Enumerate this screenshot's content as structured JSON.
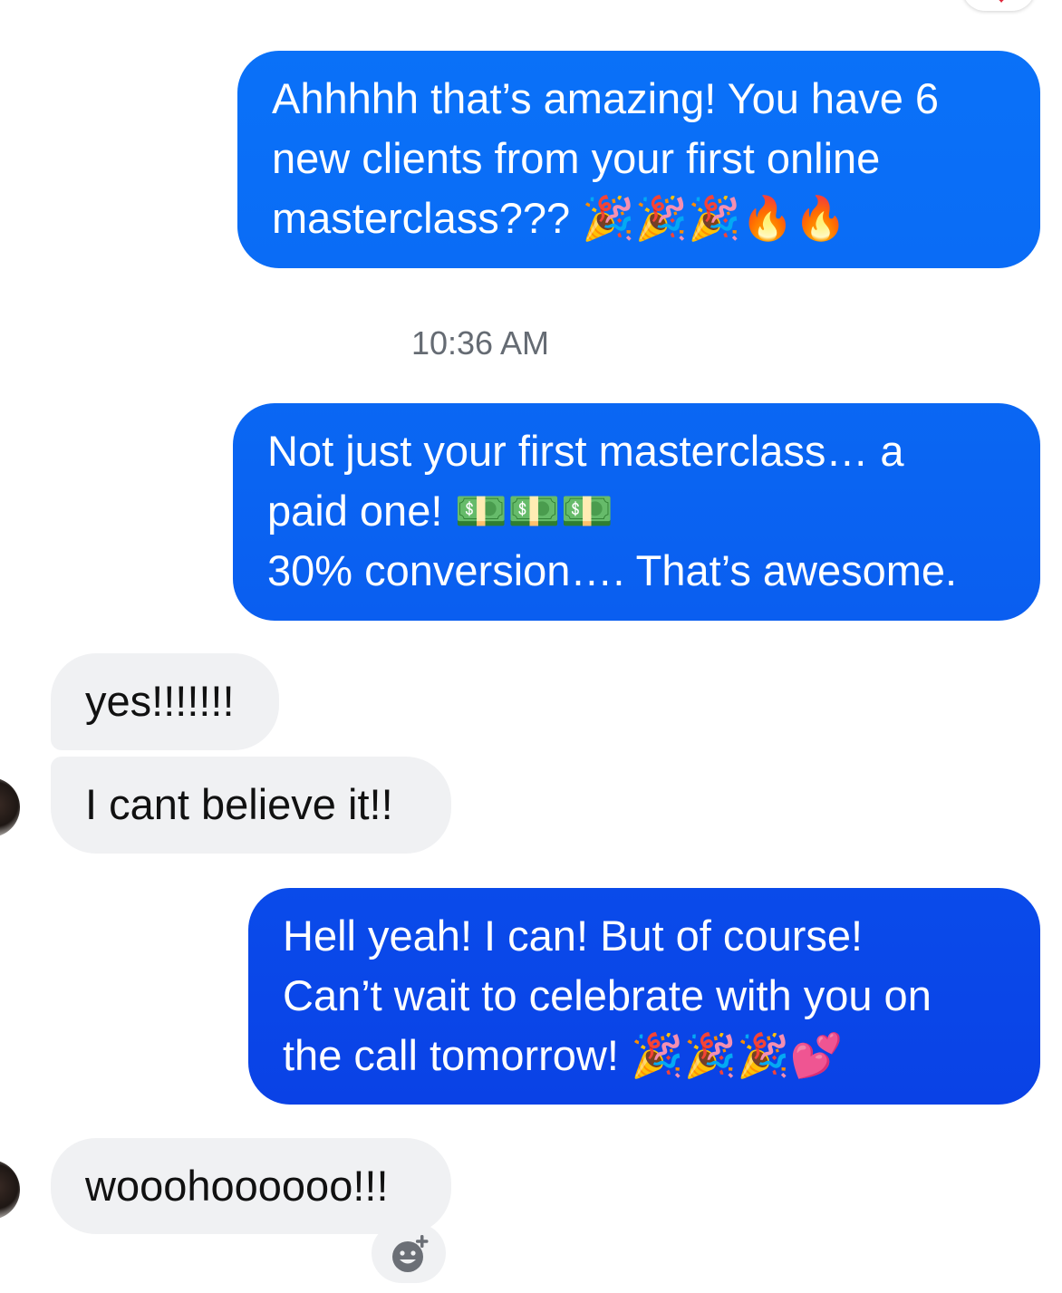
{
  "messages": [
    {
      "direction": "outgoing",
      "text": "Ahhhhh that’s amazing! You have 6\nnew clients from your first online\nmasterclass??? 🎉🎉🎉🔥🔥"
    },
    {
      "direction": "outgoing",
      "text": "Not just your first masterclass… a\npaid one! 💵💵💵\n30% conversion…. That’s awesome."
    },
    {
      "direction": "incoming",
      "text": "yes!!!!!!!"
    },
    {
      "direction": "incoming",
      "text": "I cant believe it!!"
    },
    {
      "direction": "outgoing",
      "text": "Hell yeah! I can! But of course!\nCan’t wait to celebrate with you on\nthe call tomorrow! 🎉🎉🎉💕"
    },
    {
      "direction": "incoming",
      "text": "wooohoooooo!!!"
    }
  ],
  "timestamp": "10:36 AM",
  "colors": {
    "outgoing_bubble": "#0a6cf6",
    "incoming_bubble": "#f0f1f3",
    "timestamp_text": "#656b73",
    "reaction_heart": "#e0273b"
  },
  "icons": {
    "react_button": "add-reaction-icon",
    "top_reaction": "heart-icon"
  }
}
